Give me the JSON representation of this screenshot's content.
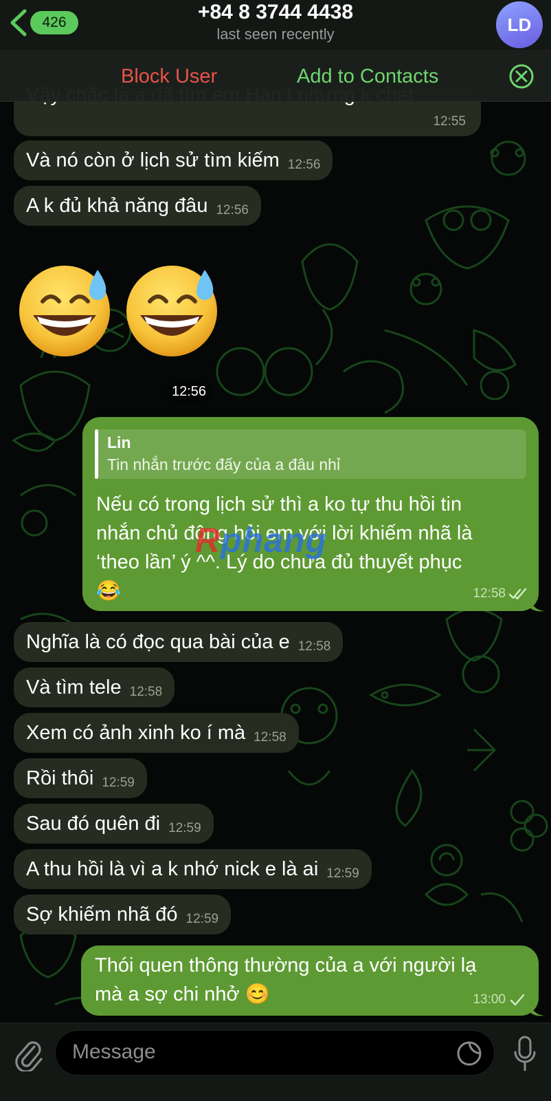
{
  "header": {
    "back_count": "426",
    "title": "+84 8 3744 4438",
    "status": "last seen recently",
    "avatar_initials": "LD"
  },
  "action_bar": {
    "block_label": "Block User",
    "add_label": "Add to Contacts"
  },
  "messages": {
    "partial_top": {
      "text": "Vậy chắc là a đã tìm em Hàn l nhưng k chat",
      "time": "12:55"
    },
    "m1": {
      "text": "Và nó còn ở lịch sử tìm kiếm",
      "time": "12:56"
    },
    "m2": {
      "text": "A k đủ khả năng đâu",
      "time": "12:56"
    },
    "sticker": {
      "emoji": "😅😅",
      "time": "12:56"
    },
    "reply_out": {
      "reply_author": "Lin",
      "reply_text": "Tin nhắn trước đấy của a đâu nhỉ",
      "line1": "Nếu có trong lịch sử thì a ko tự thu hồi tin",
      "line2": "nhắn chủ động hỏi em với lời khiếm nhã là",
      "line3": "‘theo lần’ ý ^^. Lý do chưa đủ thuyết phục",
      "line4": "😂",
      "time": "12:58",
      "status": "read"
    },
    "m3": {
      "text": "Nghĩa là có đọc qua bài của e",
      "time": "12:58"
    },
    "m4": {
      "text": "Và tìm tele",
      "time": "12:58"
    },
    "m5": {
      "text": "Xem có ảnh xinh ko í mà",
      "time": "12:58"
    },
    "m6": {
      "text": "Rồi thôi",
      "time": "12:59"
    },
    "m7": {
      "text": "Sau đó quên đi",
      "time": "12:59"
    },
    "m8": {
      "text": "A thu hồi là vì a k nhớ nick e là ai",
      "time": "12:59"
    },
    "m9": {
      "text": "Sợ khiếm nhã đó",
      "time": "12:59"
    },
    "last_out": {
      "line1": "Thói quen thông thường của a với người lạ",
      "line2": "mà a sợ chi nhở 😊",
      "time": "13:00",
      "status": "sent"
    }
  },
  "watermark": {
    "part1": "R",
    "part2": "phang"
  },
  "input": {
    "placeholder": "Message"
  },
  "colors": {
    "accent_green": "#6fd66f",
    "block_red": "#e8534a",
    "outgoing_bubble": "#5e9a34",
    "incoming_bubble": "#272d21",
    "badge_green": "#5cc95c"
  },
  "icons": [
    "back-chevron-icon",
    "close-circle-icon",
    "paperclip-icon",
    "sticker-icon",
    "microphone-icon",
    "double-check-icon",
    "single-check-icon"
  ]
}
